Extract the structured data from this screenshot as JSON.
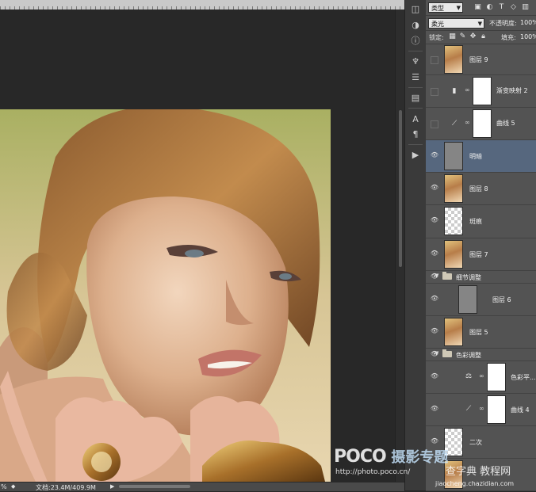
{
  "status_bar": {
    "zoom": "%",
    "doc_label": "文档:23.4M/409.9M"
  },
  "layers_panel": {
    "filter_kind": "类型",
    "blend_mode": "柔光",
    "opacity_label": "不透明度:",
    "opacity_value": "100%",
    "lock_label": "锁定:",
    "fill_label": "填充:",
    "fill_value": "100%",
    "layers": [
      {
        "name": "图层 9",
        "visible": false,
        "kind": "photo"
      },
      {
        "name": "渐变映射 2",
        "visible": false,
        "kind": "gradient-map"
      },
      {
        "name": "曲线 5",
        "visible": false,
        "kind": "curves"
      },
      {
        "name": "明暗",
        "visible": true,
        "kind": "gray",
        "selected": true
      },
      {
        "name": "图层 8",
        "visible": true,
        "kind": "photo"
      },
      {
        "name": "斑痕",
        "visible": true,
        "kind": "transparent"
      },
      {
        "name": "图层 7",
        "visible": true,
        "kind": "photo"
      },
      {
        "name": "细节调整",
        "visible": true,
        "kind": "group"
      },
      {
        "name": "图层 6",
        "visible": true,
        "kind": "gray"
      },
      {
        "name": "图层 5",
        "visible": true,
        "kind": "photo"
      },
      {
        "name": "色彩调整",
        "visible": true,
        "kind": "group"
      },
      {
        "name": "色彩平...",
        "visible": true,
        "kind": "color-balance"
      },
      {
        "name": "曲线 4",
        "visible": true,
        "kind": "curves"
      },
      {
        "name": "二次",
        "visible": true,
        "kind": "transparent"
      }
    ]
  },
  "watermark": {
    "brand": "POCO",
    "brand_suffix": "摄影专题",
    "url": "http://photo.poco.cn/",
    "site2": "查字典 教程网",
    "site2_url": "jiaocheng.chazidian.com"
  }
}
